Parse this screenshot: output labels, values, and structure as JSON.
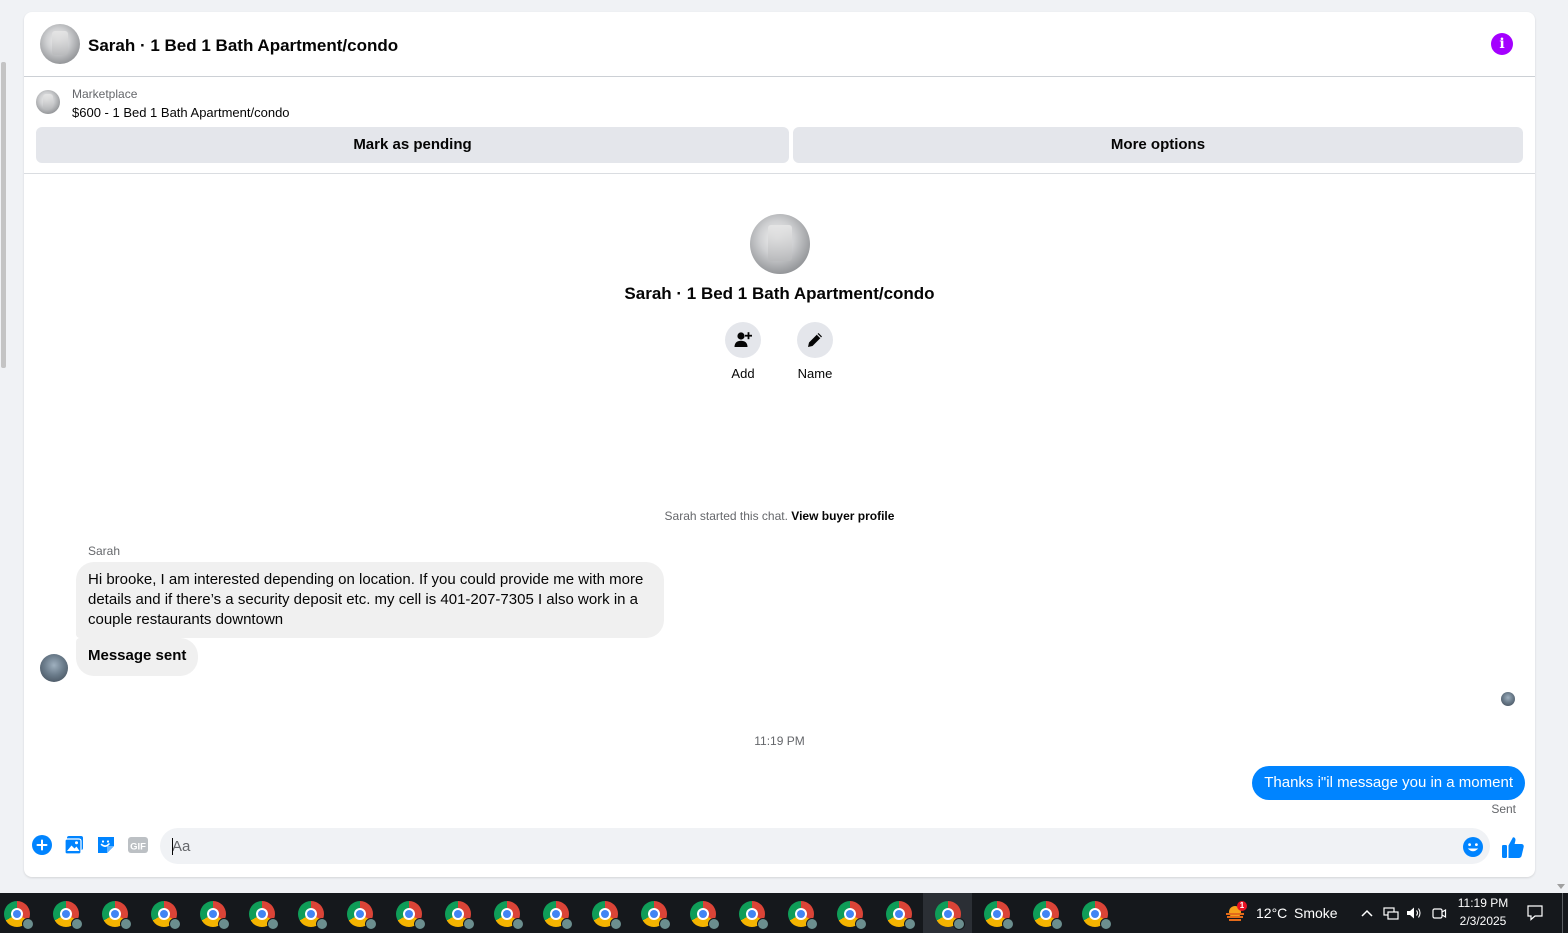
{
  "header": {
    "title": "Sarah · 1 Bed 1 Bath Apartment/condo"
  },
  "listing": {
    "kicker": "Marketplace",
    "price_title": "$600 - 1 Bed 1 Bath Apartment/condo",
    "mark_pending_label": "Mark as pending",
    "more_options_label": "More options"
  },
  "profile": {
    "name": "Sarah · 1 Bed 1 Bath Apartment/condo",
    "add_label": "Add",
    "name_label": "Name"
  },
  "chat": {
    "started_text": "Sarah started this chat.",
    "view_buyer_profile": "View buyer profile",
    "sender_name": "Sarah",
    "messages": [
      {
        "from": "Sarah",
        "text": "Hi brooke, I am interested depending on location. If you could provide me with more details and if there’s a security deposit etc. my cell is 401-207-7305 I also work in a couple restaurants downtown"
      },
      {
        "from": "Sarah",
        "text": "Message sent"
      }
    ],
    "timestamp": "11:19 PM",
    "outgoing_text": "Thanks i\"il message you in a moment",
    "sent_status": "Sent"
  },
  "composer": {
    "placeholder": "Aa",
    "gif_label": "GIF"
  },
  "taskbar": {
    "weather_temp": "12°C",
    "weather_desc": "Smoke",
    "weather_badge": "1",
    "clock_time": "11:19 PM",
    "clock_date": "2/3/2025",
    "app_count": 23
  },
  "colors": {
    "accent_blue": "#0084ff",
    "info_purple": "#a400ff",
    "button_gray": "#e4e6eb",
    "taskbar": "#15181c"
  }
}
